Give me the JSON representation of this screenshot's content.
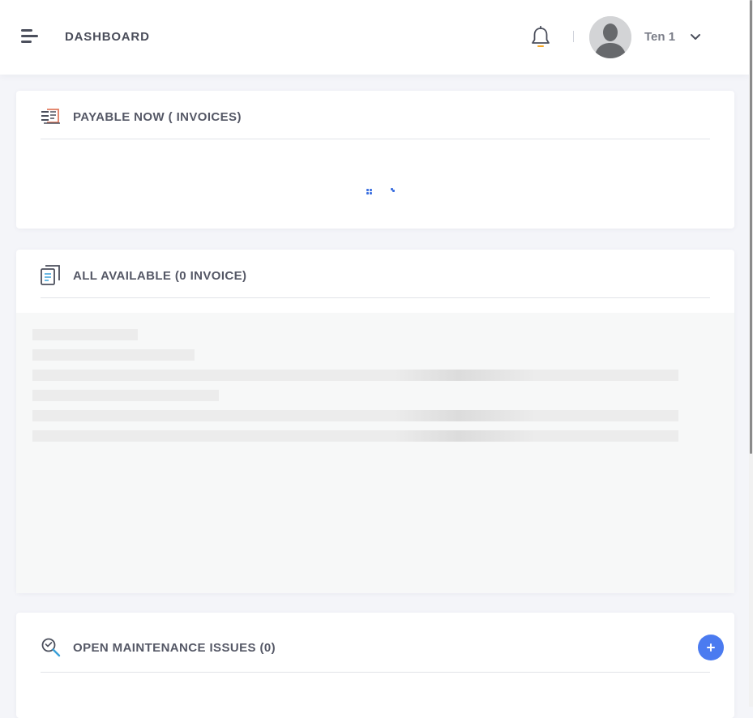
{
  "header": {
    "title": "DASHBOARD",
    "user_name": "Ten 1",
    "menu_icon": "hamburger-menu-icon",
    "bell_icon": "bell-icon",
    "chevron_icon": "chevron-down-icon",
    "notification_accent": "#f5a623"
  },
  "cards": {
    "payable": {
      "title": "PAYABLE NOW ( INVOICES)",
      "icon": "invoice-stack-icon",
      "state": "loading"
    },
    "available": {
      "title": "ALL AVAILABLE (0 INVOICE)",
      "icon": "document-copy-icon",
      "state": "skeleton-loading"
    },
    "maintenance": {
      "title": "OPEN MAINTENANCE ISSUES (0)",
      "icon": "wrench-search-icon",
      "add_icon": "plus-icon"
    }
  },
  "colors": {
    "accent": "#4b7bf0",
    "spinner": "#3b6fe0",
    "background": "#f4f5f9",
    "card": "#ffffff"
  }
}
